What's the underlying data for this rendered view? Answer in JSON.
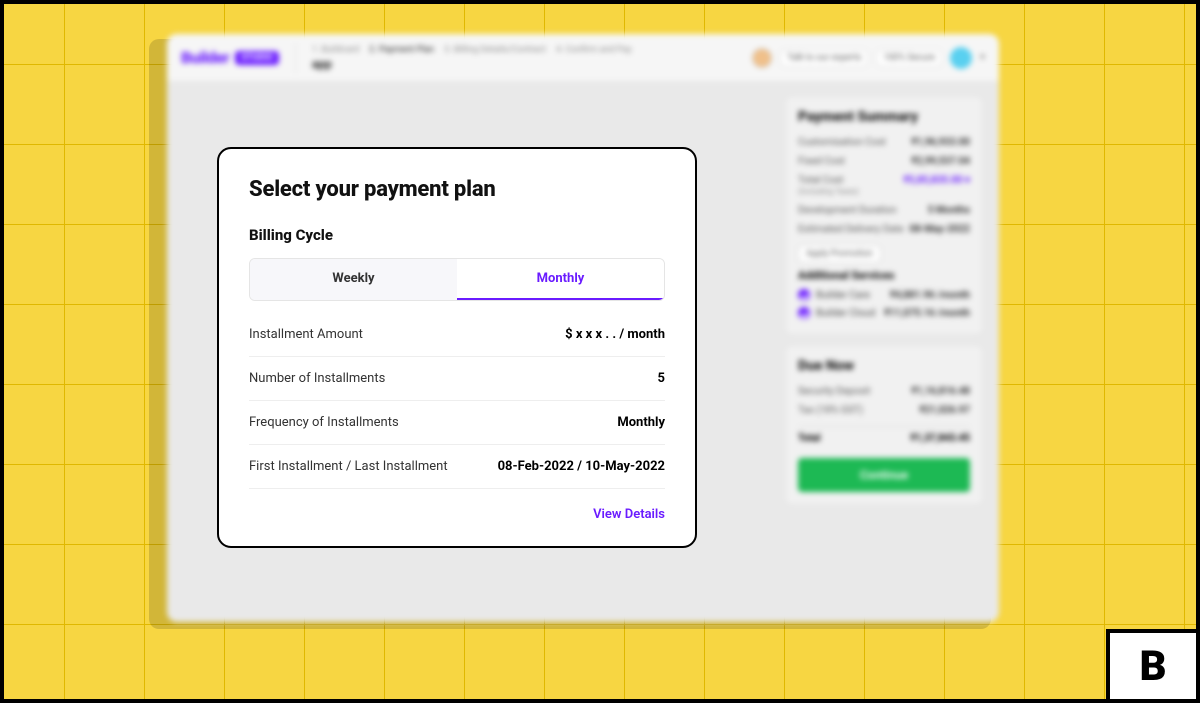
{
  "brand": {
    "logo_text": "Builder",
    "logo_badge": "STUDIO"
  },
  "header": {
    "breadcrumbs": [
      "1. Buildcard",
      "2. Payment Plan",
      "3. Billing Details/Contract",
      "4. Confirm and Pay"
    ],
    "app_name": "app",
    "talk_to_experts": "Talk to our experts",
    "secure_badge": "100% Secure"
  },
  "modal": {
    "title": "Select your payment plan",
    "billing_cycle_label": "Billing Cycle",
    "tabs": {
      "weekly": "Weekly",
      "monthly": "Monthly",
      "active": "monthly"
    },
    "rows": {
      "installment_amount": {
        "label": "Installment Amount",
        "value": "$ x x x . . / month"
      },
      "num_installments": {
        "label": "Number of Installments",
        "value": "5"
      },
      "frequency": {
        "label": "Frequency of Installments",
        "value": "Monthly"
      },
      "first_last": {
        "label": "First Installment / Last Installment",
        "value": "08-Feb-2022 / 10-May-2022"
      }
    },
    "view_details": "View Details"
  },
  "summary": {
    "title": "Payment Summary",
    "customisation": {
      "label": "Customisation Cost",
      "value": "₹1,96,933.00"
    },
    "fixed": {
      "label": "Fixed Cost",
      "value": "₹2,99,537.04"
    },
    "total_cost": {
      "label": "Total Cost",
      "sub": "(Including Taxes)",
      "value": "₹5,85,835.00"
    },
    "dev_duration": {
      "label": "Development Duration",
      "value": "5 Months"
    },
    "delivery": {
      "label": "Estimated Delivery Date",
      "value": "08-May-2022"
    },
    "apply_promo": "Apply Promotion"
  },
  "additional": {
    "title": "Additional Services",
    "care": {
      "label": "Builder Care",
      "value": "₹4,881.96 /month"
    },
    "cloud": {
      "label": "Builder Cloud",
      "value": "₹11,075.16 /month"
    }
  },
  "due": {
    "title": "Due Now",
    "deposit": {
      "label": "Security Deposit",
      "value": "₹1,16,816.48"
    },
    "tax": {
      "label": "Tax (18% GST)",
      "value": "₹21,026.97"
    },
    "total": {
      "label": "Total",
      "value": "₹1,37,843.45"
    },
    "continue": "Continue"
  },
  "corner_badge": "B"
}
